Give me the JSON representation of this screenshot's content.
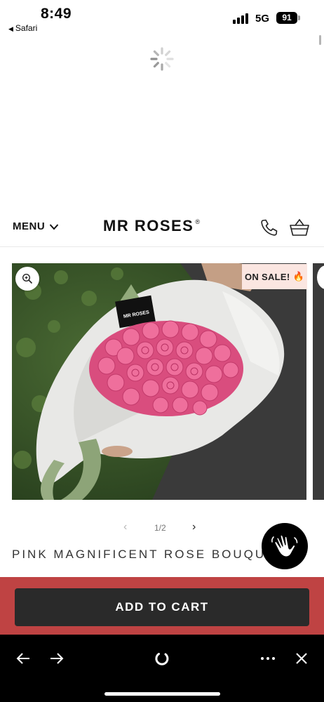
{
  "status_bar": {
    "time": "8:49",
    "back_app": "Safari",
    "network": "5G",
    "battery": "91"
  },
  "header": {
    "menu_label": "MENU",
    "brand": "MR ROSES",
    "brand_mark": "®"
  },
  "gallery": {
    "sale_badge": "ON SALE!",
    "sale_emoji": "🔥",
    "card_text": "MR ROSES",
    "pager": "1/2"
  },
  "product": {
    "title": "PINK MAGNIFICENT ROSE BOUQUET"
  },
  "cart": {
    "button_label": "ADD TO CART"
  },
  "colors": {
    "cart_bar": "#bf4343",
    "cart_button": "#2a2a2a",
    "sale_badge_bg": "#fbe6e1",
    "rose": "#e8578c"
  },
  "icons": [
    "chevron-down-icon",
    "phone-icon",
    "basket-icon",
    "zoom-icon",
    "fire-icon",
    "chevron-left-icon",
    "chevron-right-icon",
    "wave-hand-icon",
    "back-arrow-icon",
    "forward-arrow-icon",
    "reload-icon",
    "more-icon",
    "close-icon"
  ]
}
